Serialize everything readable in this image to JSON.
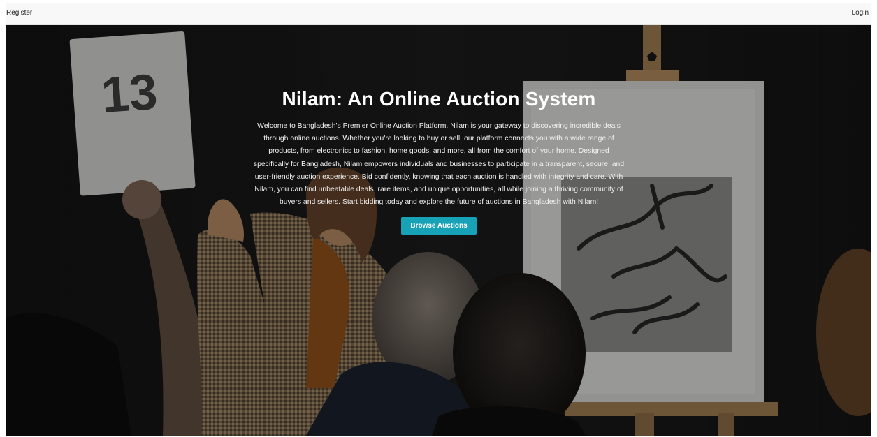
{
  "nav": {
    "register_label": "Register",
    "login_label": "Login"
  },
  "hero": {
    "title": "Nilam: An Online Auction System",
    "description": "Welcome to Bangladesh's Premier Online Auction Platform. Nilam is your gateway to discovering incredible deals through online auctions. Whether you're looking to buy or sell, our platform connects you with a wide range of products, from electronics to fashion, home goods, and more, all from the comfort of your home. Designed specifically for Bangladesh, Nilam empowers individuals and businesses to participate in a transparent, secure, and user-friendly auction experience. Bid confidently, knowing that each auction is handled with integrity and care. With Nilam, you can find unbeatable deals, rare items, and unique opportunities, all while joining a thriving community of buyers and sellers. Start bidding today and explore the future of auctions in Bangladesh with Nilam!",
    "button_label": "Browse Auctions",
    "paddle_number": "13"
  },
  "colors": {
    "accent": "#17a2b8",
    "navbar_bg": "#f8f8f8"
  }
}
